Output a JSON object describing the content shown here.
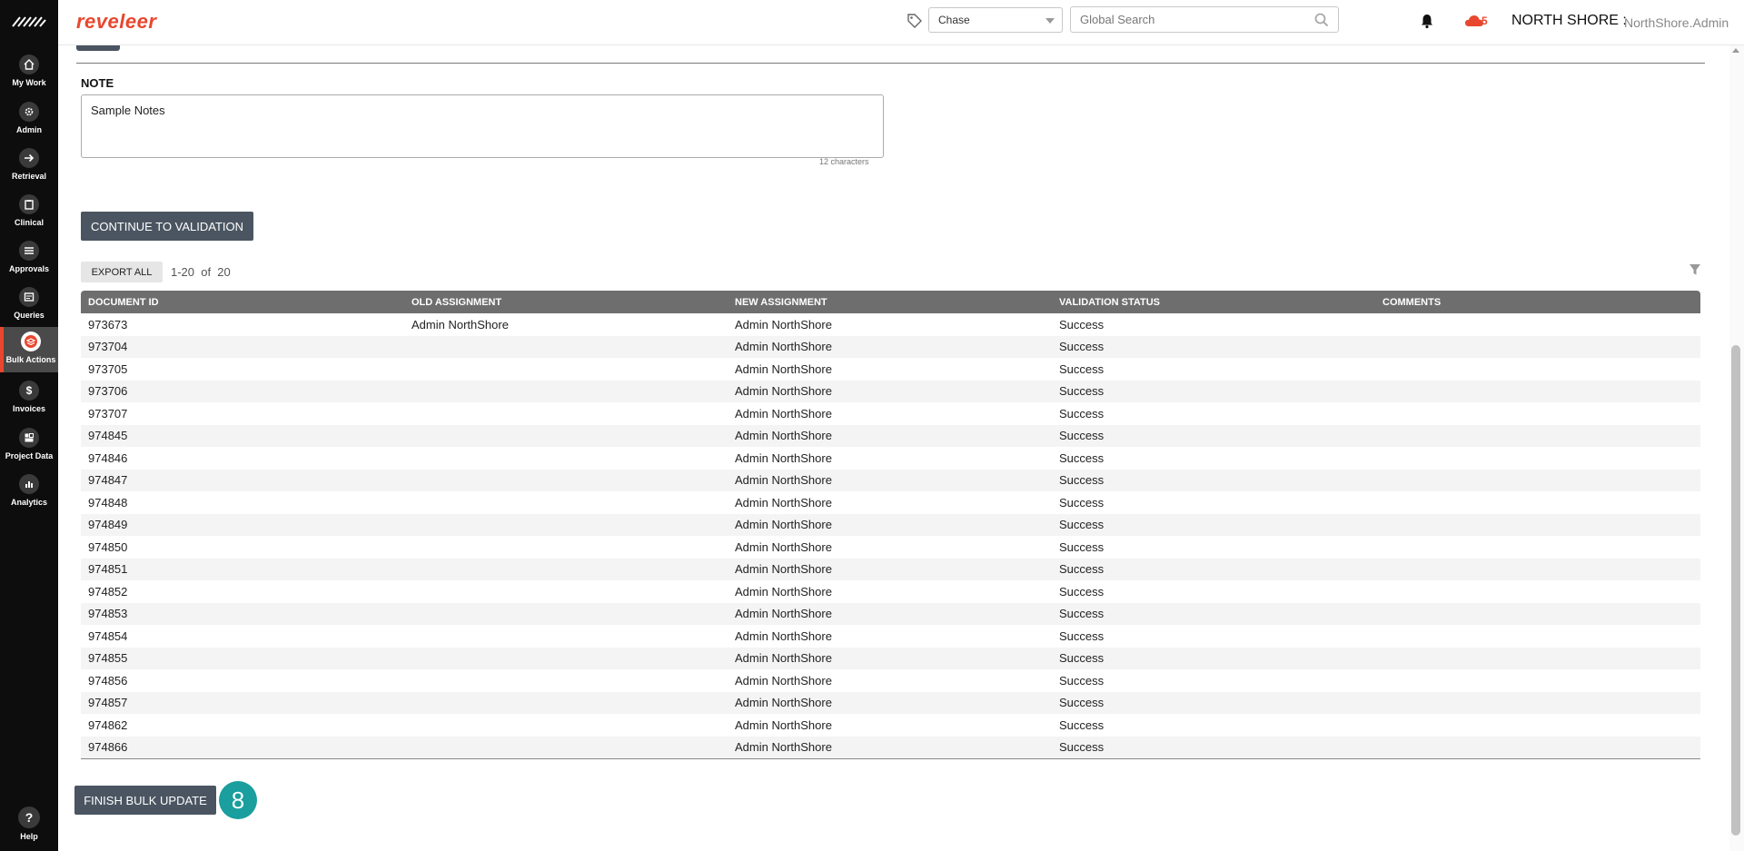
{
  "sidebar": {
    "logo_icon": "reveleer-logo-mark",
    "items": [
      {
        "label": "My Work",
        "icon": "home-icon"
      },
      {
        "label": "Admin",
        "icon": "gear-icon"
      },
      {
        "label": "Retrieval",
        "icon": "arrow-right-icon"
      },
      {
        "label": "Clinical",
        "icon": "clipboard-icon"
      },
      {
        "label": "Approvals",
        "icon": "list-icon"
      },
      {
        "label": "Queries",
        "icon": "queries-icon"
      },
      {
        "label": "Bulk Actions",
        "icon": "layers-icon",
        "active": true
      },
      {
        "label": "Invoices",
        "icon": "dollar-icon"
      },
      {
        "label": "Project Data",
        "icon": "grid-icon"
      },
      {
        "label": "Analytics",
        "icon": "bar-chart-icon"
      }
    ],
    "help_label": "Help",
    "help_glyph": "?"
  },
  "header": {
    "brand": "reveleer",
    "project_select": "Chase",
    "search_placeholder": "Global Search",
    "cloud_count": "5",
    "org_name": "NORTH SHORE :",
    "user_name": "NorthShore.Admin"
  },
  "note": {
    "label": "NOTE",
    "value": "Sample Notes",
    "char_count": "12 characters"
  },
  "actions": {
    "continue_label": "CONTINUE TO VALIDATION",
    "export_label": "EXPORT ALL",
    "paging": "1-20  of  20",
    "finish_label": "FINISH BULK UPDATE",
    "step_badge": "8"
  },
  "table": {
    "headers": [
      "DOCUMENT ID",
      "OLD ASSIGNMENT",
      "NEW ASSIGNMENT",
      "VALIDATION STATUS",
      "COMMENTS"
    ],
    "rows": [
      [
        "973673",
        "Admin NorthShore",
        "Admin NorthShore",
        "Success",
        ""
      ],
      [
        "973704",
        "",
        "Admin NorthShore",
        "Success",
        ""
      ],
      [
        "973705",
        "",
        "Admin NorthShore",
        "Success",
        ""
      ],
      [
        "973706",
        "",
        "Admin NorthShore",
        "Success",
        ""
      ],
      [
        "973707",
        "",
        "Admin NorthShore",
        "Success",
        ""
      ],
      [
        "974845",
        "",
        "Admin NorthShore",
        "Success",
        ""
      ],
      [
        "974846",
        "",
        "Admin NorthShore",
        "Success",
        ""
      ],
      [
        "974847",
        "",
        "Admin NorthShore",
        "Success",
        ""
      ],
      [
        "974848",
        "",
        "Admin NorthShore",
        "Success",
        ""
      ],
      [
        "974849",
        "",
        "Admin NorthShore",
        "Success",
        ""
      ],
      [
        "974850",
        "",
        "Admin NorthShore",
        "Success",
        ""
      ],
      [
        "974851",
        "",
        "Admin NorthShore",
        "Success",
        ""
      ],
      [
        "974852",
        "",
        "Admin NorthShore",
        "Success",
        ""
      ],
      [
        "974853",
        "",
        "Admin NorthShore",
        "Success",
        ""
      ],
      [
        "974854",
        "",
        "Admin NorthShore",
        "Success",
        ""
      ],
      [
        "974855",
        "",
        "Admin NorthShore",
        "Success",
        ""
      ],
      [
        "974856",
        "",
        "Admin NorthShore",
        "Success",
        ""
      ],
      [
        "974857",
        "",
        "Admin NorthShore",
        "Success",
        ""
      ],
      [
        "974862",
        "",
        "Admin NorthShore",
        "Success",
        ""
      ],
      [
        "974866",
        "",
        "Admin NorthShore",
        "Success",
        ""
      ]
    ]
  },
  "colors": {
    "brand": "#e8472f",
    "sidebar_bg": "#0d0d0d",
    "button_dark": "#4a5561",
    "table_header": "#6e6e6e",
    "step_badge": "#1a9e9e"
  }
}
